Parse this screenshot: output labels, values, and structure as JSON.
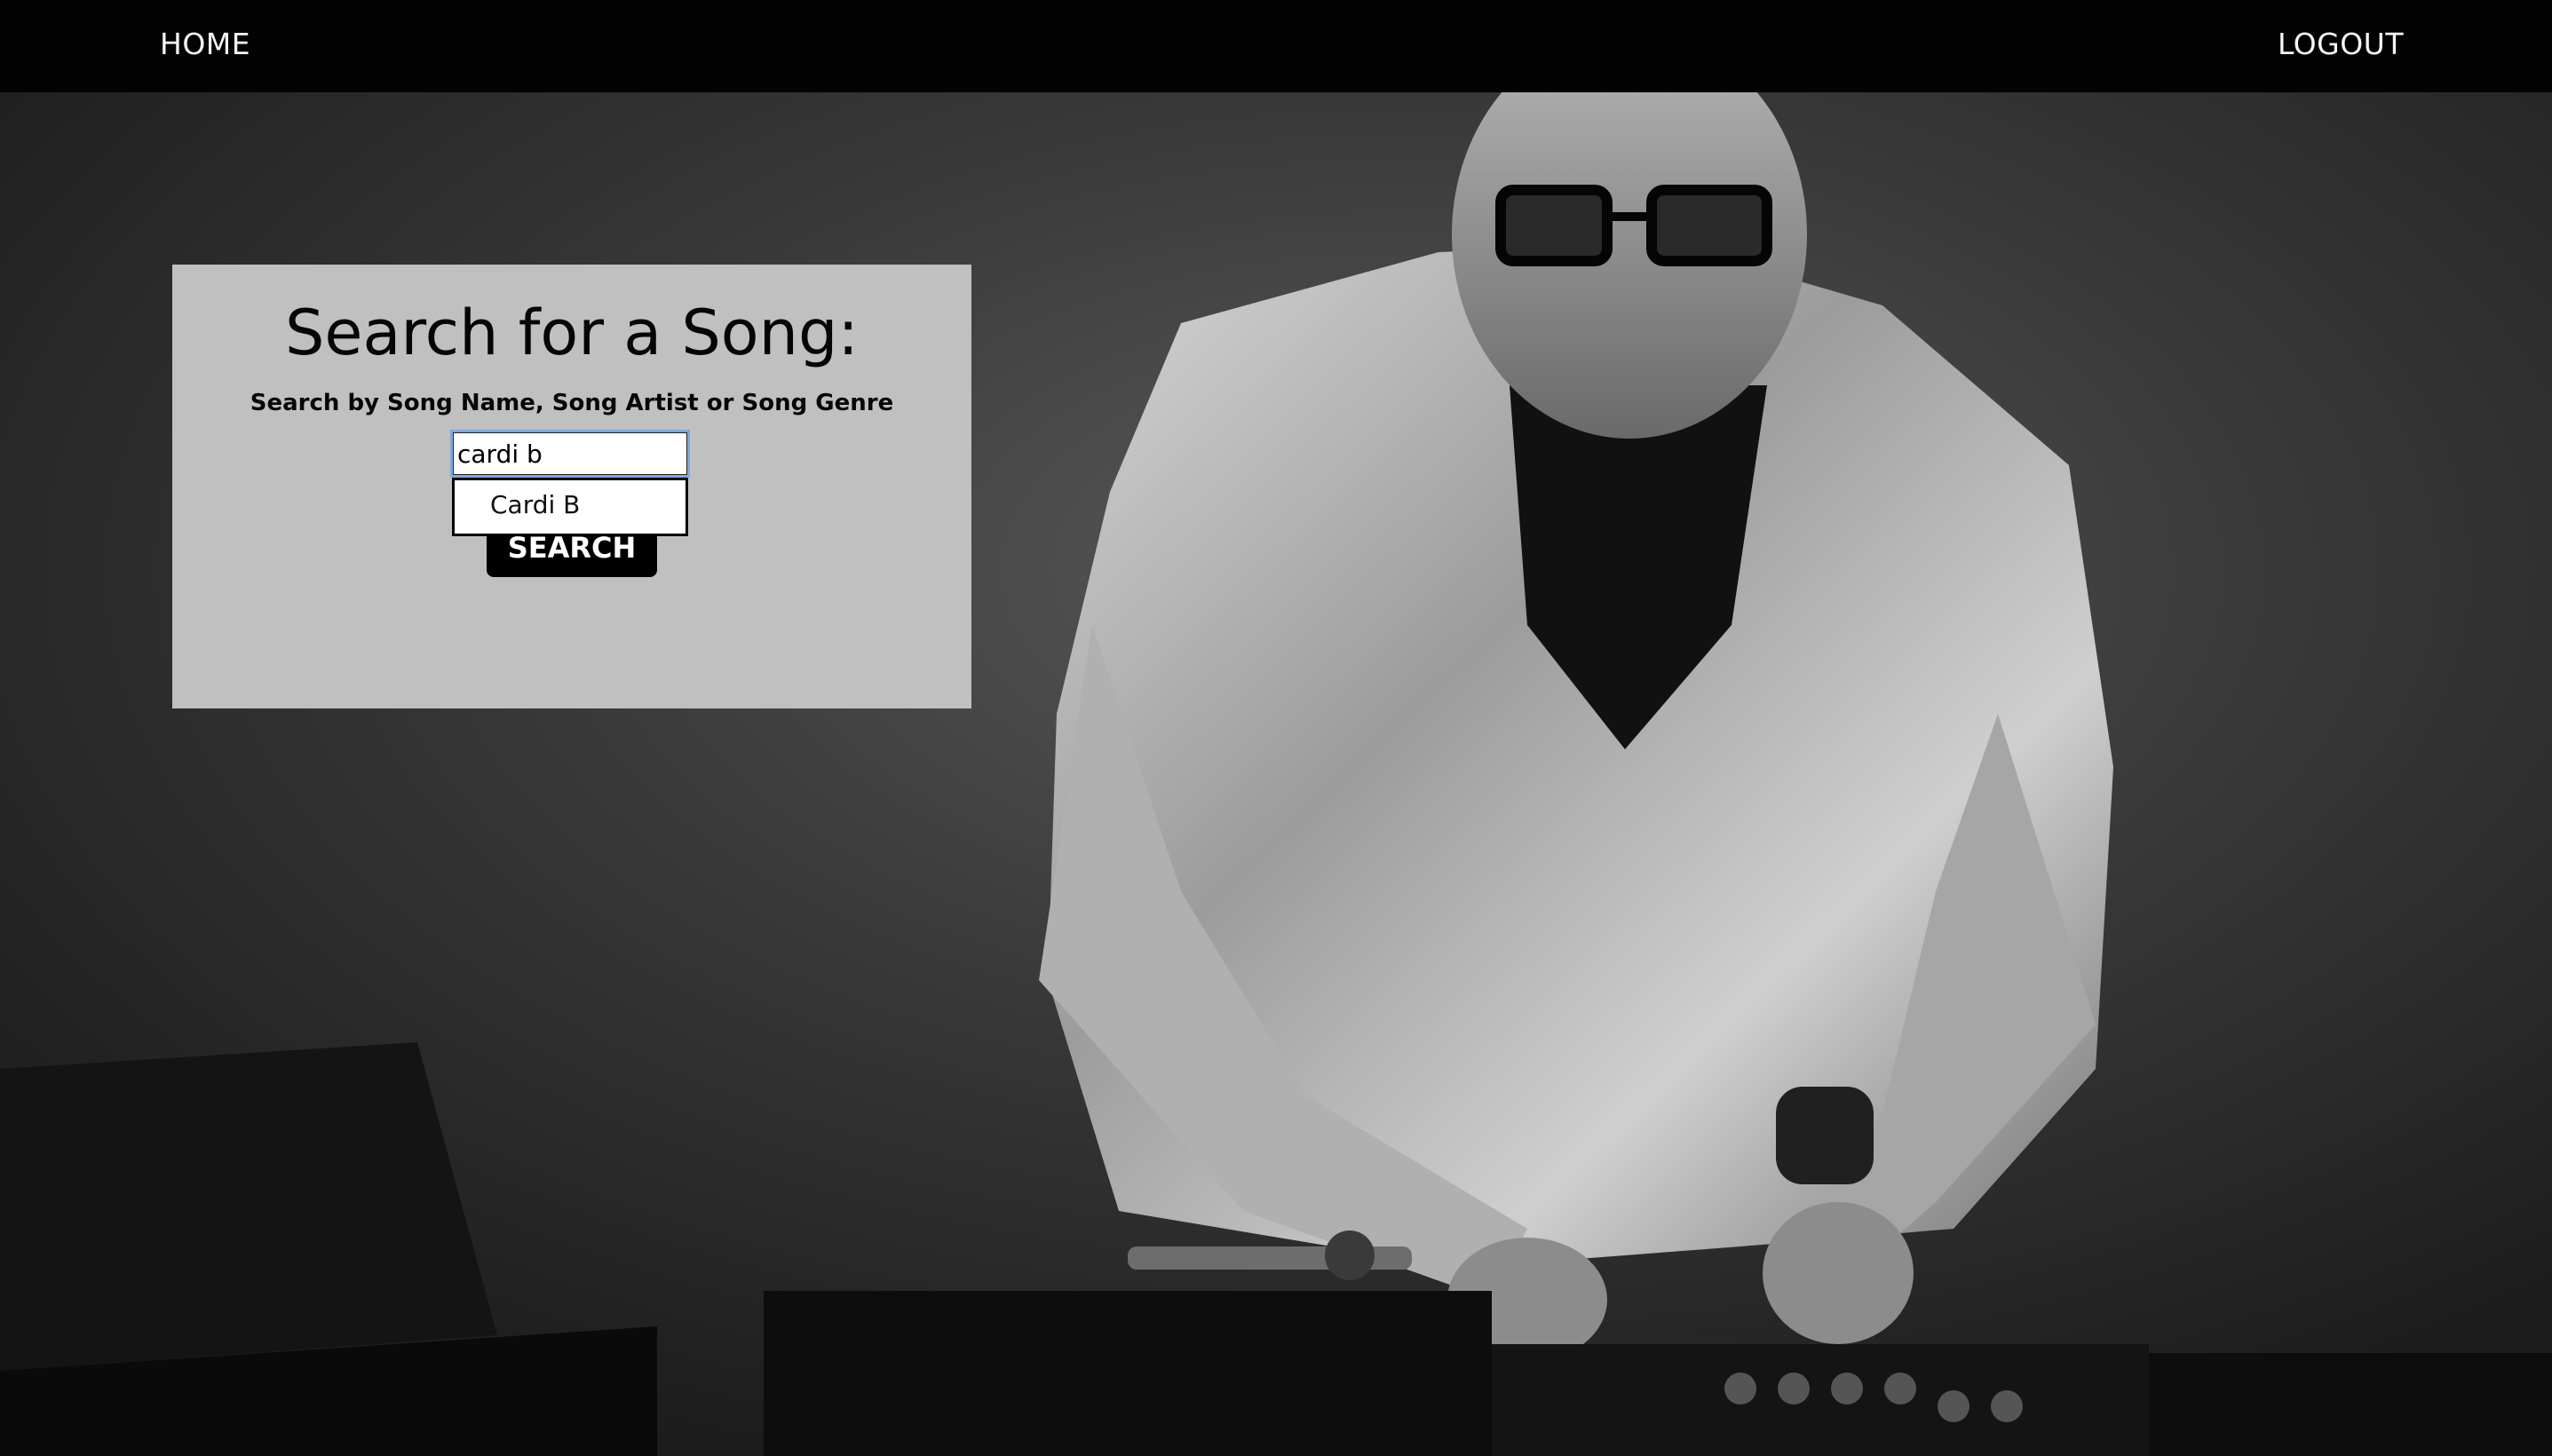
{
  "nav": {
    "home_label": "HOME",
    "logout_label": "LOGOUT"
  },
  "search": {
    "title": "Search for a Song:",
    "subtitle": "Search by Song Name, Song Artist or Song Genre",
    "input_value": "cardi b",
    "button_label": "SEARCH",
    "suggestions": [
      "Cardi B"
    ]
  },
  "background": {
    "icon": "dj-photo",
    "panel_color": "#c0c0c0",
    "nav_color": "#030303"
  }
}
